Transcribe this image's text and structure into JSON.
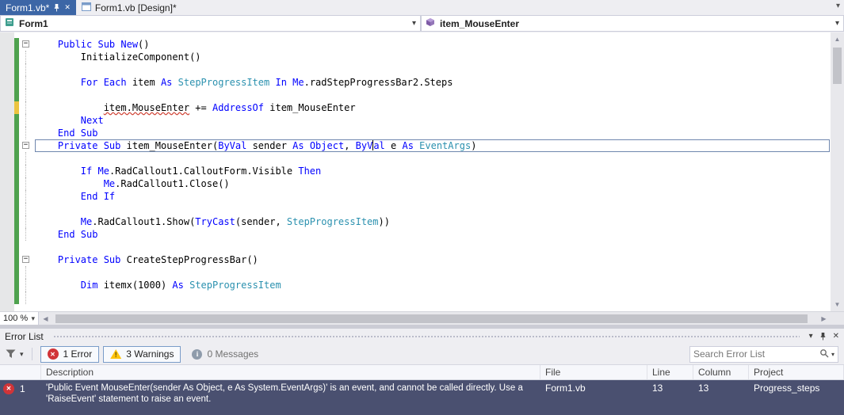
{
  "colors": {
    "accent_tab": "#3C66A6",
    "keyword": "#0000FF",
    "type_name": "#2B91AF",
    "selection_row": "#4A5070",
    "change_saved": "#4EA24E",
    "change_unsaved": "#ECC440",
    "error": "#D13438",
    "warning": "#FFC40D"
  },
  "tab_bar": {
    "tabs": [
      {
        "label": "Form1.vb*"
      },
      {
        "label": "Form1.vb [Design]*"
      }
    ]
  },
  "navigation_bar": {
    "scope": "Form1",
    "member": "item_MouseEnter"
  },
  "editor": {
    "zoom_level": "100 %",
    "lines": [
      {
        "fold": true,
        "bar": "green",
        "tokens": [
          [
            "k",
            "    Public Sub New"
          ],
          [
            "p",
            "()"
          ]
        ]
      },
      {
        "bar": "green",
        "guide": true,
        "tokens": [
          [
            "p",
            "        InitializeComponent()"
          ]
        ]
      },
      {
        "bar": "green",
        "guide": true,
        "tokens": []
      },
      {
        "bar": "green",
        "guide": true,
        "tokens": [
          [
            "p",
            "        "
          ],
          [
            "k",
            "For Each"
          ],
          [
            "p",
            " item "
          ],
          [
            "k",
            "As"
          ],
          [
            "p",
            " "
          ],
          [
            "t",
            "StepProgressItem"
          ],
          [
            "p",
            " "
          ],
          [
            "k",
            "In"
          ],
          [
            "p",
            " "
          ],
          [
            "k",
            "Me"
          ],
          [
            "p",
            ".radStepProgressBar2.Steps"
          ]
        ]
      },
      {
        "bar": "green",
        "guide": true,
        "tokens": []
      },
      {
        "bar": "yellow",
        "guide": true,
        "tokens": [
          [
            "p",
            "            "
          ],
          [
            "sq",
            "item.MouseEnter"
          ],
          [
            "p",
            " += "
          ],
          [
            "k",
            "AddressOf"
          ],
          [
            "p",
            " item_MouseEnter"
          ]
        ]
      },
      {
        "bar": "green",
        "guide": true,
        "tokens": [
          [
            "p",
            "        "
          ],
          [
            "k",
            "Next"
          ]
        ]
      },
      {
        "bar": "green",
        "guide": true,
        "tokens": [
          [
            "p",
            "    "
          ],
          [
            "k",
            "End Sub"
          ]
        ]
      },
      {
        "fold": true,
        "bar": "green",
        "box": true,
        "tokens": [
          [
            "p",
            "    "
          ],
          [
            "k",
            "Private Sub"
          ],
          [
            "p",
            " item_MouseEnter("
          ],
          [
            "k",
            "ByVal"
          ],
          [
            "p",
            " sender "
          ],
          [
            "k",
            "As"
          ],
          [
            "p",
            " "
          ],
          [
            "k",
            "Object"
          ],
          [
            "p",
            ", "
          ],
          [
            "k",
            "ByV"
          ],
          [
            "caret",
            ""
          ],
          [
            "k",
            "al"
          ],
          [
            "p",
            " e "
          ],
          [
            "k",
            "As"
          ],
          [
            "p",
            " "
          ],
          [
            "t",
            "EventArgs"
          ],
          [
            "p",
            ")"
          ]
        ]
      },
      {
        "bar": "green",
        "guide": true,
        "tokens": []
      },
      {
        "bar": "green",
        "guide": true,
        "tokens": [
          [
            "p",
            "        "
          ],
          [
            "k",
            "If"
          ],
          [
            "p",
            " "
          ],
          [
            "k",
            "Me"
          ],
          [
            "p",
            ".RadCallout1.CalloutForm.Visible "
          ],
          [
            "k",
            "Then"
          ]
        ]
      },
      {
        "bar": "green",
        "guide": true,
        "tokens": [
          [
            "p",
            "            "
          ],
          [
            "k",
            "Me"
          ],
          [
            "p",
            ".RadCallout1.Close()"
          ]
        ]
      },
      {
        "bar": "green",
        "guide": true,
        "tokens": [
          [
            "p",
            "        "
          ],
          [
            "k",
            "End If"
          ]
        ]
      },
      {
        "bar": "green",
        "guide": true,
        "tokens": []
      },
      {
        "bar": "green",
        "guide": true,
        "tokens": [
          [
            "p",
            "        "
          ],
          [
            "k",
            "Me"
          ],
          [
            "p",
            ".RadCallout1.Show("
          ],
          [
            "k",
            "TryCast"
          ],
          [
            "p",
            "(sender, "
          ],
          [
            "t",
            "StepProgressItem"
          ],
          [
            "p",
            "))"
          ]
        ]
      },
      {
        "bar": "green",
        "guide": true,
        "tokens": [
          [
            "p",
            "    "
          ],
          [
            "k",
            "End Sub"
          ]
        ]
      },
      {
        "bar": "green",
        "tokens": []
      },
      {
        "fold": true,
        "bar": "green",
        "tokens": [
          [
            "p",
            "    "
          ],
          [
            "k",
            "Private Sub"
          ],
          [
            "p",
            " CreateStepProgressBar()"
          ]
        ]
      },
      {
        "bar": "green",
        "guide": true,
        "tokens": []
      },
      {
        "bar": "green",
        "guide": true,
        "tokens": [
          [
            "p",
            "        "
          ],
          [
            "k",
            "Dim"
          ],
          [
            "p",
            " itemx(1000) "
          ],
          [
            "k",
            "As"
          ],
          [
            "p",
            " "
          ],
          [
            "t",
            "StepProgressItem"
          ]
        ]
      },
      {
        "bar": "green",
        "guide": true,
        "tokens": []
      }
    ]
  },
  "error_list": {
    "title": "Error List",
    "toolbar": {
      "errors_label": "1 Error",
      "warnings_label": "3 Warnings",
      "messages_label": "0 Messages",
      "search_placeholder": "Search Error List"
    },
    "columns": [
      "Description",
      "File",
      "Line",
      "Column",
      "Project"
    ],
    "rows": [
      {
        "severity": "error",
        "count": "1",
        "description": "'Public Event MouseEnter(sender As Object, e As System.EventArgs)' is an event, and cannot be called directly. Use a 'RaiseEvent' statement to raise an event.",
        "file": "Form1.vb",
        "line": "13",
        "column": "13",
        "project": "Progress_steps"
      }
    ]
  }
}
